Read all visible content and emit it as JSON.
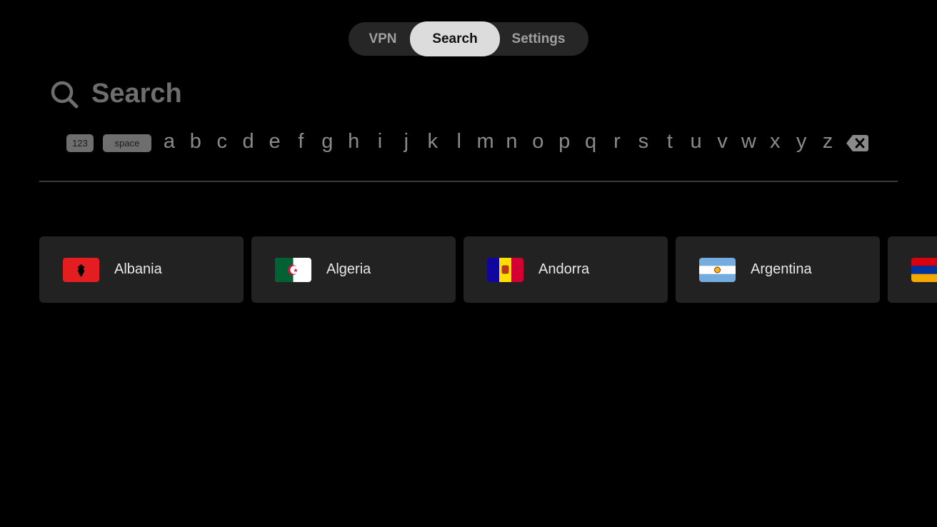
{
  "tabs": [
    {
      "label": "VPN",
      "active": false
    },
    {
      "label": "Search",
      "active": true
    },
    {
      "label": "Settings",
      "active": false
    }
  ],
  "search": {
    "placeholder": "Search",
    "icon": "magnifying-glass-icon"
  },
  "keyboard": {
    "numbers_key": "123",
    "space_key": "space",
    "letters": [
      "a",
      "b",
      "c",
      "d",
      "e",
      "f",
      "g",
      "h",
      "i",
      "j",
      "k",
      "l",
      "m",
      "n",
      "o",
      "p",
      "q",
      "r",
      "s",
      "t",
      "u",
      "v",
      "w",
      "x",
      "y",
      "z"
    ],
    "delete_icon": "backspace-icon"
  },
  "countries": [
    {
      "name": "Albania",
      "flag": "albania-flag",
      "colors": [
        "#e41e20",
        "#000000"
      ]
    },
    {
      "name": "Algeria",
      "flag": "algeria-flag",
      "colors": [
        "#006233",
        "#ffffff",
        "#d21034"
      ]
    },
    {
      "name": "Andorra",
      "flag": "andorra-flag",
      "colors": [
        "#10069f",
        "#fedf00",
        "#d50032"
      ]
    },
    {
      "name": "Argentina",
      "flag": "argentina-flag",
      "colors": [
        "#74acdf",
        "#ffffff",
        "#f6b40e"
      ]
    },
    {
      "name": "",
      "flag": "armenia-flag",
      "colors": [
        "#d90012",
        "#0033a0",
        "#f2a800"
      ]
    }
  ]
}
